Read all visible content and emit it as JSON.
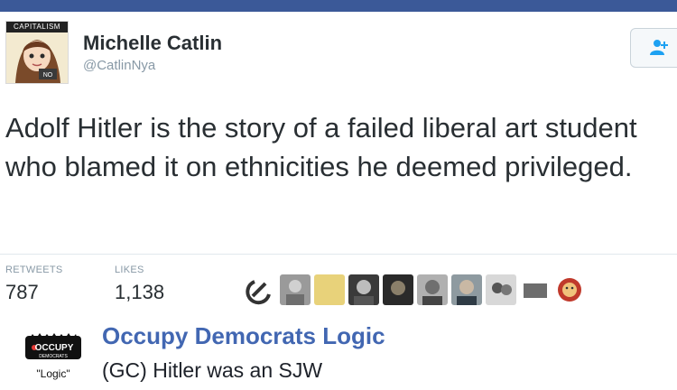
{
  "tweet": {
    "avatar_tag": "CAPITALISM",
    "display_name": "Michelle Catlin",
    "handle": "@CatlinNya",
    "text": "Adolf Hitler is the story of a failed liberal art student who blamed it on ethnicities he deemed privileged.",
    "stats": {
      "retweets_label": "RETWEETS",
      "retweets": "787",
      "likes_label": "LIKES",
      "likes": "1,138"
    },
    "liker_icons": [
      "hammer-sickle-icon",
      "avatar",
      "avatar",
      "avatar",
      "avatar",
      "avatar",
      "avatar",
      "avatar",
      "avatar",
      "lion-icon"
    ]
  },
  "page": {
    "logo_text": "OCCUPY",
    "logo_sub": "DEMOCRATS",
    "logo_caption": "\"Logic\"",
    "name": "Occupy Democrats Logic",
    "post_text": "(GC) Hitler was an SJW"
  },
  "colors": {
    "facebook_blue": "#3b5998",
    "link_blue": "#4267b2",
    "twitter_text": "#292f33",
    "twitter_gray": "#8899a6"
  }
}
